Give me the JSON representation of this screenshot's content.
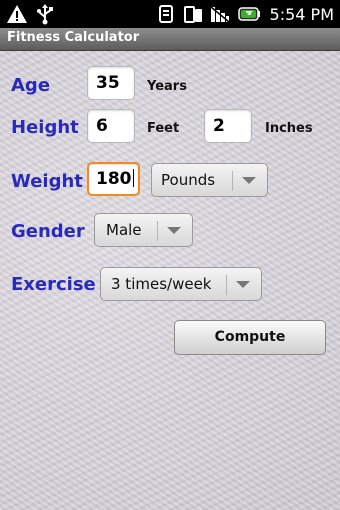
{
  "status_bar": {
    "time": "5:54 PM",
    "icons": [
      "warning-icon",
      "usb-icon",
      "sync-icon",
      "phone-icon",
      "signal-icon",
      "battery-icon"
    ]
  },
  "app": {
    "title": "Fitness Calculator"
  },
  "form": {
    "age": {
      "label": "Age",
      "value": "35",
      "unit": "Years"
    },
    "height": {
      "label": "Height",
      "feet_value": "6",
      "feet_unit": "Feet",
      "inches_value": "2",
      "inches_unit": "Inches"
    },
    "weight": {
      "label": "Weight",
      "value": "180",
      "unit_selected": "Pounds"
    },
    "gender": {
      "label": "Gender",
      "selected": "Male"
    },
    "exercise": {
      "label": "Exercise",
      "selected": "3 times/week"
    },
    "compute_label": "Compute"
  },
  "colors": {
    "label_blue": "#2a2ab8",
    "focus_orange": "#f08c1e",
    "titlebar": "#6e6e6e"
  }
}
